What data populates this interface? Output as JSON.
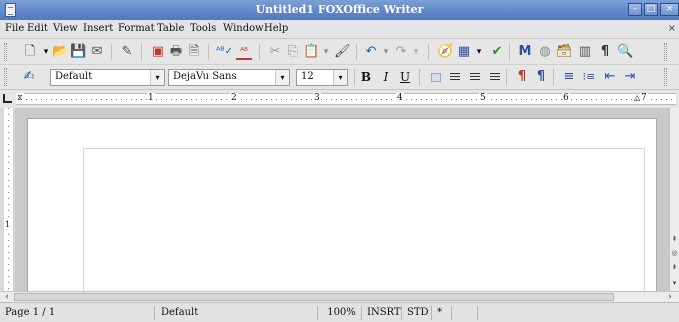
{
  "window": {
    "title": "Untitled1 - FOXOffice Writer",
    "title_display": "Untitled1   FOXOffice Writer",
    "controls": {
      "minimize": "–",
      "maximize": "□",
      "close": "×"
    }
  },
  "menubar": {
    "items": [
      {
        "label": "File"
      },
      {
        "label": "Edit"
      },
      {
        "label": "View"
      },
      {
        "label": "Insert"
      },
      {
        "label": "Format"
      },
      {
        "label": "Table"
      },
      {
        "label": "Tools"
      },
      {
        "label": "Window"
      },
      {
        "label": "Help"
      }
    ],
    "close_glyph": "×"
  },
  "toolbar_standard": {
    "icons": [
      "new-document-icon",
      "open-folder-icon",
      "save-icon",
      "email-icon",
      "edit-file-icon",
      "export-pdf-icon",
      "print-icon",
      "page-preview-icon",
      "spellcheck-icon",
      "autospellcheck-icon",
      "cut-icon",
      "copy-icon",
      "paste-icon",
      "clone-format-icon",
      "undo-icon",
      "redo-icon",
      "navigator-icon",
      "insert-table-icon",
      "show-draw-functions-icon",
      "find-replace-icon",
      "gallery-icon",
      "data-sources-icon",
      "nonprinting-characters-icon",
      "zoom-icon"
    ],
    "glyphs": {
      "new": "🗋",
      "open": "📂",
      "save": "💾",
      "email": "✉",
      "edit": "✎",
      "pdf": "▣",
      "print": "🖶",
      "preview": "🗎",
      "spell": "ᴬᴮ✓",
      "autospell": "ᴬᴮ",
      "cut": "✂",
      "copy": "⎘",
      "paste": "📋",
      "clone": "🖌",
      "undo": "↶",
      "redo": "↷",
      "navigator": "🧭",
      "table": "▦",
      "draw": "✔",
      "find": "🔍",
      "gallery": "◍",
      "datasource": "🗃",
      "pilcrow": "¶",
      "zoom": "🔍",
      "dropdown": "▾"
    }
  },
  "toolbar_formatting": {
    "styles_icon": "paragraph-styles-icon",
    "paragraph_style": "Default",
    "font_name": "DejaVu Sans",
    "font_size": "12",
    "bold": "B",
    "italic": "I",
    "underline": "U",
    "numbering_glyph": "≡",
    "bullets_glyph": "⁝≡",
    "decrease_indent_glyph": "⇤",
    "increase_indent_glyph": "⇥",
    "ltr_glyph": "¶",
    "rtl_glyph": "¶"
  },
  "ruler": {
    "numbers": [
      "1",
      "2",
      "3",
      "4",
      "5",
      "6",
      "7"
    ],
    "vertical_number": "1"
  },
  "statusbar": {
    "page": "Page 1 / 1",
    "style": "Default",
    "zoom": "100%",
    "insert_mode": "INSRT",
    "selection_mode": "STD",
    "modified": "*"
  },
  "scroll": {
    "up": "▴",
    "down": "▾",
    "left": "‹",
    "right": "›"
  },
  "colors": {
    "titlebar": "#5f86c8",
    "chrome": "#e6e6e6",
    "document_background": "#c9c9c9",
    "page": "#ffffff"
  }
}
